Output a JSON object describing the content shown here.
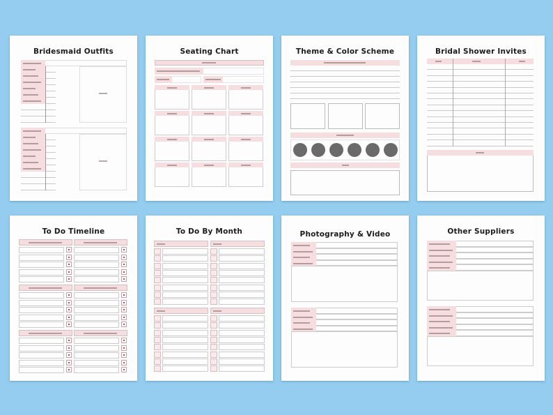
{
  "colors": {
    "background": "#94cdef",
    "page": "#fdfdfd",
    "accent_pink": "#f6dde0",
    "swatch_circle": "#6a6a6a"
  },
  "pages": [
    {
      "title": "Bridesmaid Outfits"
    },
    {
      "title": "Seating Chart"
    },
    {
      "title": "Theme & Color Scheme"
    },
    {
      "title": "Bridal Shower Invites"
    },
    {
      "title": "To Do Timeline"
    },
    {
      "title": "To Do By Month"
    },
    {
      "title": "Photography & Video"
    },
    {
      "title": "Other Suppliers"
    }
  ]
}
